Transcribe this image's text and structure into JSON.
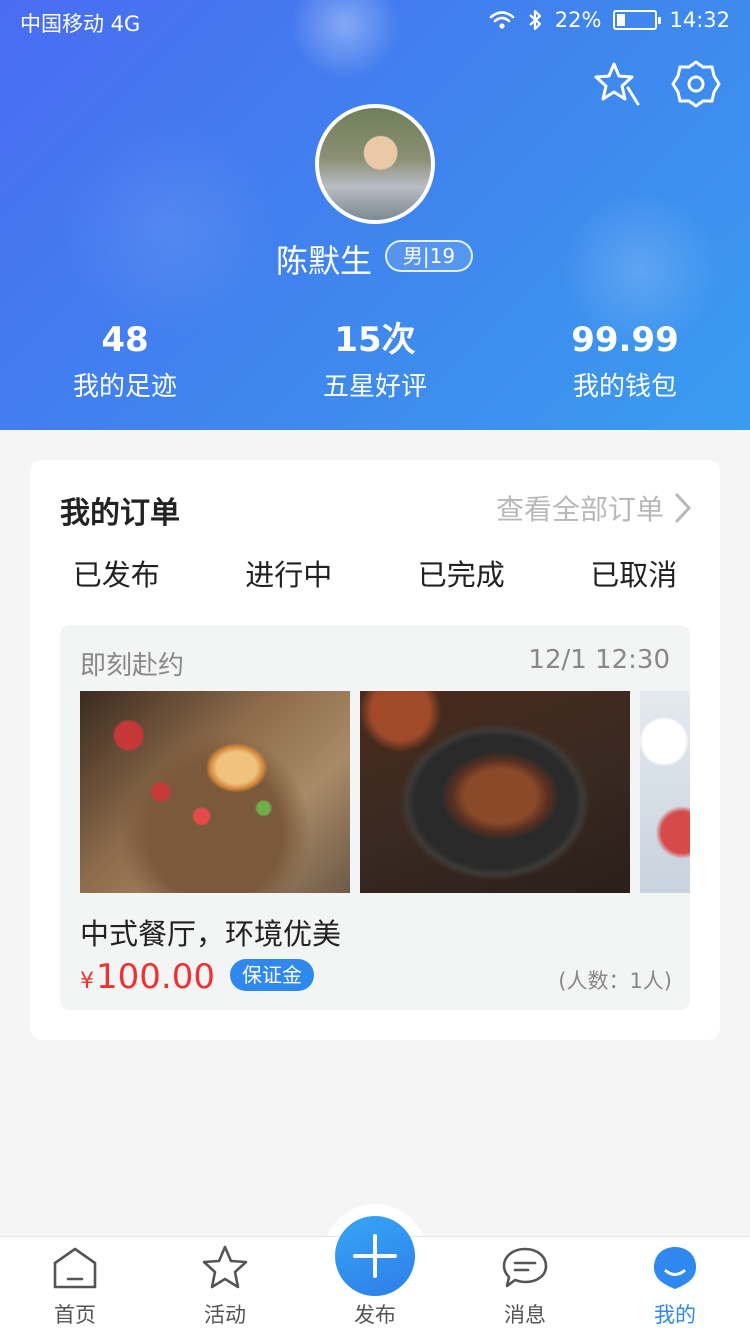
{
  "status_bar": {
    "carrier": "中国移动 4G",
    "battery_percent": "22%",
    "battery_level": 0.22,
    "time": "14:32",
    "icons": [
      "wifi-icon",
      "bluetooth-icon",
      "battery-icon"
    ]
  },
  "header": {
    "icons": [
      "star-sparkle-icon",
      "gear-icon"
    ],
    "username": "陈默生",
    "badge": "男|19"
  },
  "stats": [
    {
      "value": "48",
      "label": "我的足迹"
    },
    {
      "value": "15次",
      "label": "五星好评"
    },
    {
      "value": "99.99",
      "label": "我的钱包"
    }
  ],
  "orders": {
    "title": "我的订单",
    "view_all": "查看全部订单",
    "tabs": [
      "已发布",
      "进行中",
      "已完成",
      "已取消"
    ],
    "item": {
      "type": "即刻赴约",
      "time": "12/1 12:30",
      "description": "中式餐厅，环境优美",
      "currency": "¥",
      "price": "100.00",
      "deposit_tag": "保证金",
      "people": "(人数：1人)"
    }
  },
  "tabbar": {
    "items": [
      {
        "label": "首页",
        "icon": "home-icon"
      },
      {
        "label": "活动",
        "icon": "star-icon"
      },
      {
        "label": "发布",
        "icon": "plus-icon"
      },
      {
        "label": "消息",
        "icon": "chat-icon"
      },
      {
        "label": "我的",
        "icon": "profile-icon"
      }
    ],
    "active": "我的",
    "accent_color": "#2f88ee"
  },
  "colors": {
    "header_gradient_start": "#4a6cf2",
    "header_gradient_end": "#3a9df0",
    "price_red": "#f2302f",
    "deposit_blue": "#2f88ee"
  }
}
